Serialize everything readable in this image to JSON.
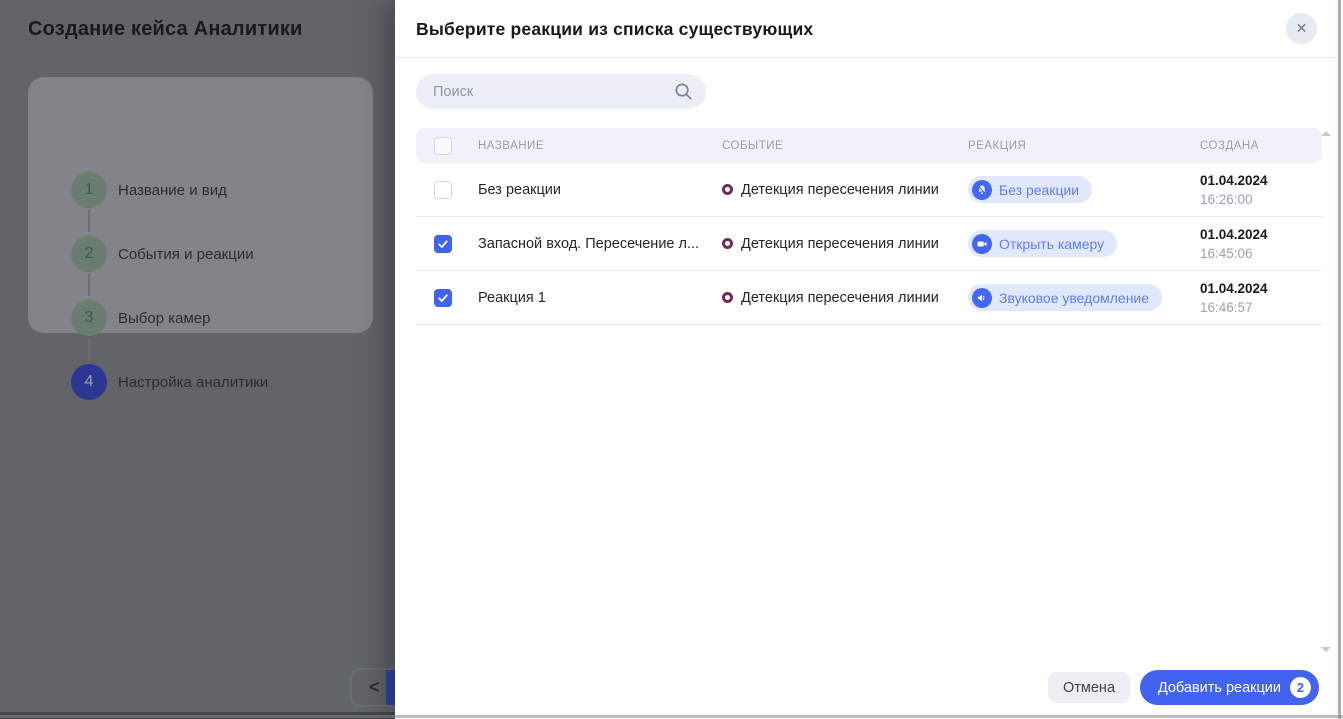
{
  "background": {
    "page_title": "Создание кейса Аналитики",
    "steps": [
      {
        "number": "1",
        "label": "Название и вид",
        "state": "done"
      },
      {
        "number": "2",
        "label": "События и реакции",
        "state": "done"
      },
      {
        "number": "3",
        "label": "Выбор камер",
        "state": "done"
      },
      {
        "number": "4",
        "label": "Настройка аналитики",
        "state": "active"
      }
    ],
    "back_chevron": "<"
  },
  "modal": {
    "title": "Выберите реакции из списка существующих",
    "close_icon": "✕",
    "search": {
      "placeholder": "Поиск",
      "value": ""
    },
    "table": {
      "columns": [
        "НАЗВАНИЕ",
        "СОБЫТИЕ",
        "РЕАКЦИЯ",
        "СОЗДАНА"
      ],
      "select_all_checked": false,
      "rows": [
        {
          "checked": false,
          "name": "Без реакции",
          "event": "Детекция пересечения линии",
          "reaction": {
            "label": "Без реакции",
            "icon": "bell-off-icon"
          },
          "created_date": "01.04.2024",
          "created_time": "16:26:00"
        },
        {
          "checked": true,
          "name": "Запасной вход. Пересечение л...",
          "event": "Детекция пересечения линии",
          "reaction": {
            "label": "Открыть камеру",
            "icon": "video-camera-icon"
          },
          "created_date": "01.04.2024",
          "created_time": "16:45:06"
        },
        {
          "checked": true,
          "name": "Реакция 1",
          "event": "Детекция пересечения линии",
          "reaction": {
            "label": "Звуковое уведомление",
            "icon": "speaker-icon"
          },
          "created_date": "01.04.2024",
          "created_time": "16:46:57"
        }
      ]
    },
    "footer": {
      "cancel_label": "Отмена",
      "submit_label": "Добавить реакции",
      "submit_count": "2"
    }
  },
  "colors": {
    "accent_blue": "#4262F0",
    "badge_bg": "#E2E8FC",
    "badge_text": "#5F7DF8",
    "event_ring": "#6E2B5E",
    "step_active": "#3D4CD8",
    "step_done": "#9DB8A4",
    "table_header_bg": "#F1F2F9"
  }
}
